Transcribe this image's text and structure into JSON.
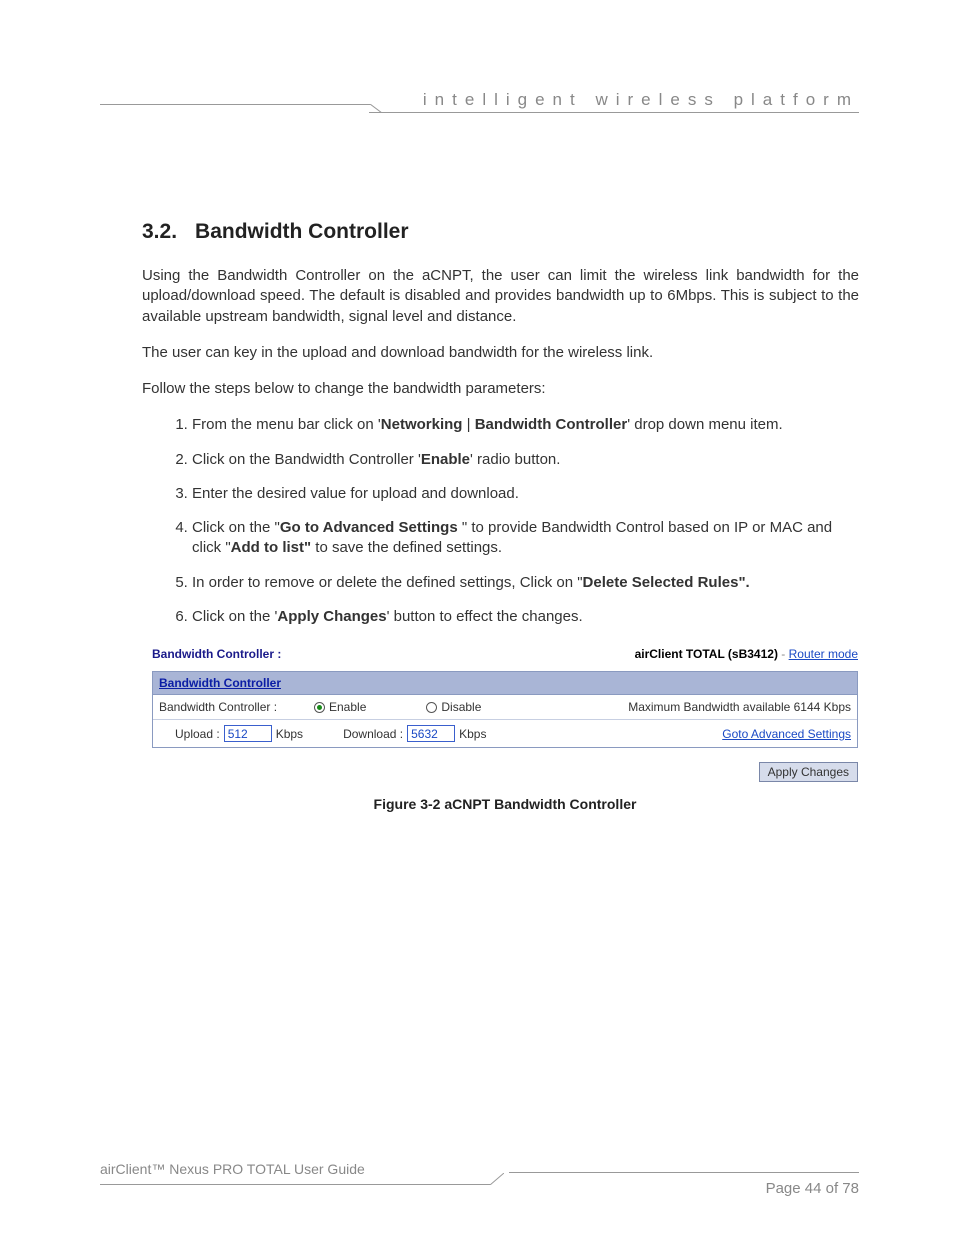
{
  "header": {
    "tagline": "intelligent wireless platform"
  },
  "section": {
    "number": "3.2.",
    "title": "Bandwidth Controller",
    "para1": "Using the Bandwidth Controller on the aCNPT, the user can limit the wireless link bandwidth for the upload/download speed. The default is disabled and provides bandwidth up to 6Mbps. This is subject to the available upstream bandwidth, signal level and distance.",
    "para2": "The user can key in the upload and download bandwidth for the wireless link.",
    "para3": "Follow the steps below to change the bandwidth parameters:"
  },
  "steps": {
    "s1a": "From the menu bar click on '",
    "s1b": "Networking",
    "s1c": " | ",
    "s1d": "Bandwidth Controller",
    "s1e": "' drop down menu item.",
    "s2a": "Click on the Bandwidth Controller '",
    "s2b": "Enable",
    "s2c": "' radio button.",
    "s3": "Enter the desired value for upload and download.",
    "s4a": "Click on the \"",
    "s4b": "Go to Advanced Settings",
    "s4c": " \" to provide Bandwidth Control based on IP or MAC and click \"",
    "s4d": "Add to list\"",
    "s4e": " to save the defined settings.",
    "s5a": "In order to remove or delete the defined settings, Click on \"",
    "s5b": "Delete Selected Rules\".",
    "s6a": "Click on the '",
    "s6b": "Apply Changes",
    "s6c": "' button to effect the changes."
  },
  "figure": {
    "top_left": "Bandwidth Controller :",
    "device": "airClient TOTAL (sB3412)",
    "dash": " - ",
    "mode": "Router mode",
    "panel_head": "Bandwidth Controller",
    "bc_label": "Bandwidth Controller :",
    "enable": "Enable",
    "disable": "Disable",
    "maxbw": "Maximum Bandwidth available 6144 Kbps",
    "upload_label": "Upload :",
    "upload_value": "512",
    "download_label": "Download :",
    "download_value": "5632",
    "kbps": "Kbps",
    "adv_link": "Goto Advanced Settings",
    "apply": "Apply Changes",
    "caption": "Figure 3-2 aCNPT Bandwidth Controller"
  },
  "footer": {
    "guide": "airClient™ Nexus PRO TOTAL User Guide",
    "page": "Page 44 of 78"
  }
}
